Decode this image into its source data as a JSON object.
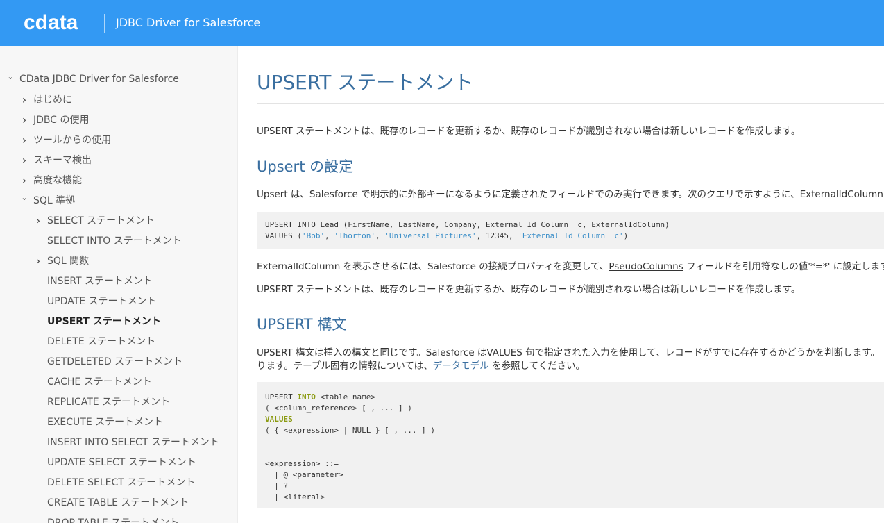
{
  "header": {
    "logo": "cdata",
    "title": "JDBC Driver for Salesforce",
    "bg_color": "#3399f3"
  },
  "sidebar": {
    "items": [
      {
        "label": "CData JDBC Driver for Salesforce",
        "chevron": "down",
        "level": 0
      },
      {
        "label": "はじめに",
        "chevron": "right",
        "level": 1
      },
      {
        "label": "JDBC の使用",
        "chevron": "right",
        "level": 1
      },
      {
        "label": "ツールからの使用",
        "chevron": "right",
        "level": 1
      },
      {
        "label": "スキーマ検出",
        "chevron": "right",
        "level": 1
      },
      {
        "label": "高度な機能",
        "chevron": "right",
        "level": 1
      },
      {
        "label": "SQL 準拠",
        "chevron": "down",
        "level": 1
      },
      {
        "label": "SELECT ステートメント",
        "chevron": "right",
        "level": 2
      },
      {
        "label": "SELECT INTO ステートメント",
        "chevron": "",
        "level": 2
      },
      {
        "label": "SQL 関数",
        "chevron": "right",
        "level": 2
      },
      {
        "label": "INSERT ステートメント",
        "chevron": "",
        "level": 2
      },
      {
        "label": "UPDATE ステートメント",
        "chevron": "",
        "level": 2
      },
      {
        "label": "UPSERT ステートメント",
        "chevron": "",
        "level": 2,
        "active": true
      },
      {
        "label": "DELETE ステートメント",
        "chevron": "",
        "level": 2
      },
      {
        "label": "GETDELETED ステートメント",
        "chevron": "",
        "level": 2
      },
      {
        "label": "CACHE ステートメント",
        "chevron": "",
        "level": 2
      },
      {
        "label": "REPLICATE ステートメント",
        "chevron": "",
        "level": 2
      },
      {
        "label": "EXECUTE ステートメント",
        "chevron": "",
        "level": 2
      },
      {
        "label": "INSERT INTO SELECT ステートメント",
        "chevron": "",
        "level": 2
      },
      {
        "label": "UPDATE SELECT ステートメント",
        "chevron": "",
        "level": 2
      },
      {
        "label": "DELETE SELECT ステートメント",
        "chevron": "",
        "level": 2
      },
      {
        "label": "CREATE TABLE ステートメント",
        "chevron": "",
        "level": 2
      },
      {
        "label": "DROP TABLE ステートメント",
        "chevron": "",
        "level": 2
      }
    ]
  },
  "main": {
    "title": "UPSERT ステートメント",
    "intro": "UPSERT ステートメントは、既存のレコードを更新するか、既存のレコードが識別されない場合は新しいレコードを作成します。",
    "section1": {
      "heading": "Upsert の設定",
      "para": "Upsert は、Salesforce で明示的に外部キーになるように定義されたフィールドでのみ実行できます。次のクエリで示すように、ExternalIdColumn",
      "code_line1": "UPSERT INTO Lead (FirstName, LastName, Company, External_Id_Column__c, ExternalIdColumn)",
      "code_line2_prefix": "VALUES (",
      "code_line2_s1": "'Bob'",
      "code_line2_sep1": ", ",
      "code_line2_s2": "'Thorton'",
      "code_line2_sep2": ", ",
      "code_line2_s3": "'Universal Pictures'",
      "code_line2_mid": ", 12345, ",
      "code_line2_s4": "'External_Id_Column__c'",
      "code_line2_suffix": ")",
      "para2_pre": "ExternalIdColumn を表示させるには、Salesforce の接続プロパティを変更して、",
      "para2_link": "PseudoColumns",
      "para2_post": " フィールドを引用符なしの値'*=*' に設定します。",
      "para3": "UPSERT ステートメントは、既存のレコードを更新するか、既存のレコードが識別されない場合は新しいレコードを作成します。"
    },
    "section2": {
      "heading": "UPSERT 構文",
      "para_line1": "UPSERT 構文は挿入の構文と同じです。Salesforce はVALUES 句で指定された入力を使用して、レコードがすでに存在するかどうかを判断します。",
      "para_line2_pre": "ります。テーブル固有の情報については、",
      "para_line2_link": "データモデル",
      "para_line2_post": " を参照してください。",
      "code": {
        "l1_a": "UPSERT ",
        "l1_kw": "INTO",
        "l1_b": " <table_name>",
        "l2": "( <column_reference> [ , ... ] )",
        "l3_kw": "VALUES",
        "l4": "( { <expression> | NULL } [ , ... ] )",
        "l5": "<expression> ::=",
        "l6": "  | @ <parameter>",
        "l7": "  | ?",
        "l8": "  | <literal>"
      }
    }
  }
}
